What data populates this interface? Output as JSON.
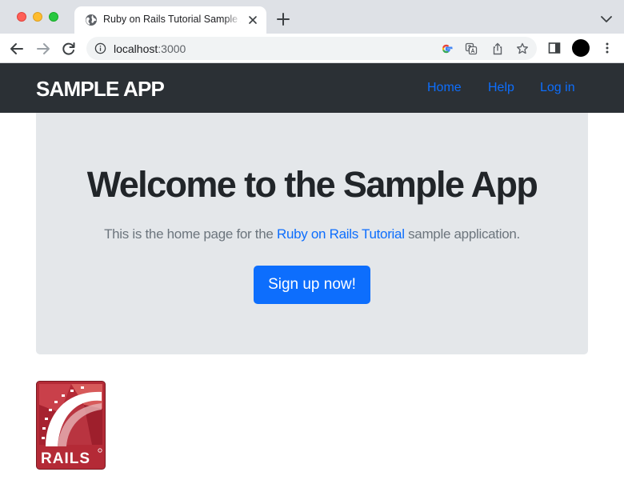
{
  "browser": {
    "tab": {
      "title": "Ruby on Rails Tutorial Sample App"
    },
    "address": {
      "host": "localhost",
      "port": ":3000"
    }
  },
  "navbar": {
    "brand": "SAMPLE APP",
    "links": [
      {
        "label": "Home"
      },
      {
        "label": "Help"
      },
      {
        "label": "Log in"
      }
    ]
  },
  "hero": {
    "title": "Welcome to the Sample App",
    "text_before": "This is the home page for the ",
    "link_text": "Ruby on Rails Tutorial",
    "text_after": " sample application.",
    "button": "Sign up now!"
  },
  "footer_logo": {
    "text": "RAILS"
  },
  "colors": {
    "navbar_bg": "#2b3035",
    "link": "#0d6efd",
    "jumbotron_bg": "#e4e7ea",
    "rails_red": "#b42a36"
  }
}
